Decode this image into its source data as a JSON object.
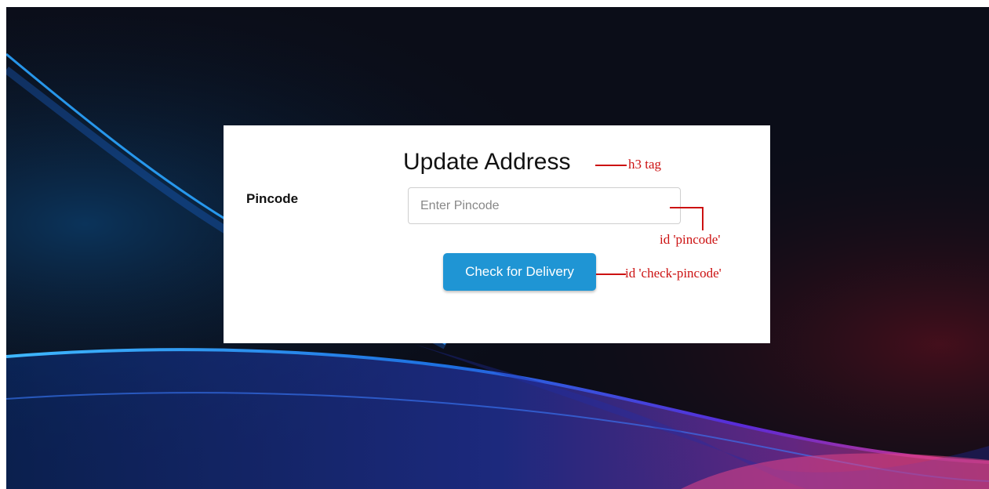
{
  "form": {
    "title": "Update Address",
    "pincode_label": "Pincode",
    "pincode_placeholder": "Enter Pincode",
    "pincode_value": "",
    "check_button_label": "Check for Delivery"
  },
  "annotations": {
    "heading_note": "h3 tag",
    "input_note": "id 'pincode'",
    "button_note": "id 'check-pincode'",
    "color": "#cc1111"
  },
  "theme": {
    "button_color": "#1f95d4",
    "background_color": "#090b14"
  }
}
